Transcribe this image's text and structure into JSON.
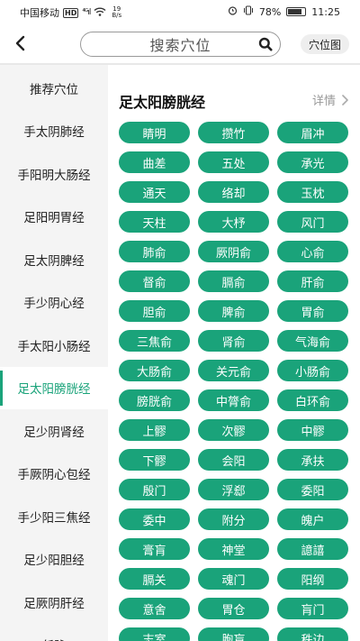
{
  "status_bar": {
    "carrier": "中国移动",
    "network_badge": "HD",
    "signal": "⁴ᴳıl",
    "speed_value": "19",
    "speed_unit": "B/s",
    "battery_level": "78%",
    "time": "11:25"
  },
  "header": {
    "search_placeholder": "搜索穴位",
    "acupoint_map_label": "穴位图"
  },
  "sidebar": {
    "items": [
      {
        "label": "推荐穴位",
        "active": false
      },
      {
        "label": "手太阴肺经",
        "active": false
      },
      {
        "label": "手阳明大肠经",
        "active": false
      },
      {
        "label": "足阳明胃经",
        "active": false
      },
      {
        "label": "足太阴脾经",
        "active": false
      },
      {
        "label": "手少阴心经",
        "active": false
      },
      {
        "label": "手太阳小肠经",
        "active": false
      },
      {
        "label": "足太阳膀胱经",
        "active": true
      },
      {
        "label": "足少阴肾经",
        "active": false
      },
      {
        "label": "手厥阴心包经",
        "active": false
      },
      {
        "label": "手少阳三焦经",
        "active": false
      },
      {
        "label": "足少阳胆经",
        "active": false
      },
      {
        "label": "足厥阴肝经",
        "active": false
      },
      {
        "label": "任脉",
        "active": false
      }
    ]
  },
  "main": {
    "section_title": "足太阳膀胱经",
    "detail_label": "详情",
    "points": [
      "睛明",
      "攒竹",
      "眉冲",
      "曲差",
      "五处",
      "承光",
      "通天",
      "络却",
      "玉枕",
      "天柱",
      "大杼",
      "风门",
      "肺俞",
      "厥阴俞",
      "心俞",
      "督俞",
      "膈俞",
      "肝俞",
      "胆俞",
      "脾俞",
      "胃俞",
      "三焦俞",
      "肾俞",
      "气海俞",
      "大肠俞",
      "关元俞",
      "小肠俞",
      "膀胱俞",
      "中膂俞",
      "白环俞",
      "上髎",
      "次髎",
      "中髎",
      "下髎",
      "会阳",
      "承扶",
      "殷门",
      "浮郄",
      "委阳",
      "委中",
      "附分",
      "魄户",
      "膏肓",
      "神堂",
      "譩譆",
      "膈关",
      "魂门",
      "阳纲",
      "意舍",
      "胃仓",
      "肓门",
      "志室",
      "胞肓",
      "秩边"
    ]
  },
  "colors": {
    "accent": "#1aa37a",
    "sidebar_bg": "#f4f4f4",
    "chip_text": "#ffffff"
  },
  "icons": {
    "back": "chevron-left-icon",
    "search": "search-icon",
    "detail": "chevron-right-icon"
  }
}
